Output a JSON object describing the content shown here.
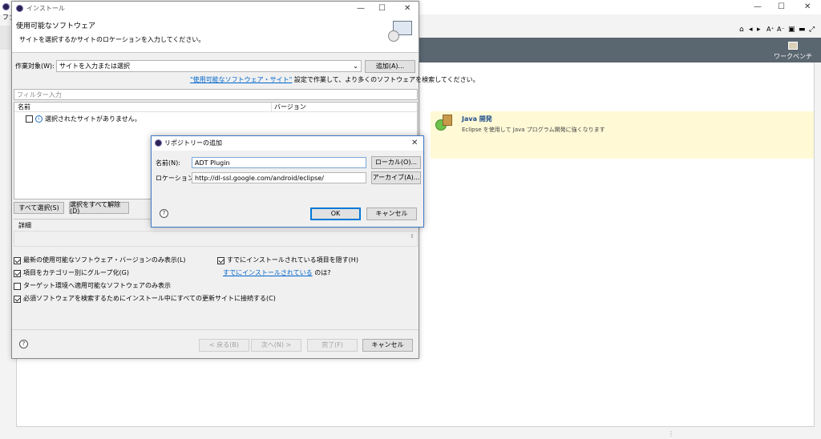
{
  "main_window": {
    "menu_fragment": "ファ",
    "controls": {
      "minimize": "—",
      "maximize": "☐",
      "close": "✕"
    }
  },
  "perspective": {
    "label": "ワークベンチ"
  },
  "welcome": {
    "java_title": "Java 開発",
    "java_desc": "Eclipse を使用して Java プログラム開発に強くなります"
  },
  "install_dialog": {
    "title": "インストール",
    "header_title": "使用可能なソフトウェア",
    "header_desc": "サイトを選択するかサイトのロケーションを入力してください。",
    "work_with_label": "作業対象(W):",
    "work_with_value": "サイトを入力または選択",
    "add_button": "追加(A)...",
    "available_sites_link": "\"使用可能なソフトウェア・サイト\"",
    "available_sites_suffix": " 設定で作業して、より多くのソフトウェアを検索してください。",
    "filter_placeholder": "フィルター入力",
    "columns": {
      "name": "名前",
      "version": "バージョン"
    },
    "tree_message": "選択されたサイトがありません。",
    "select_all": "すべて選択(S)",
    "deselect_all": "選択をすべて解除(D)",
    "details_label": "詳細",
    "options": {
      "latest_only": "最新の使用可能なソフトウェア・バージョンのみ表示(L)",
      "group_by_category": "項目をカテゴリー別にグループ化(G)",
      "target_env_only": "ターゲット環境へ適用可能なソフトウェアのみ表示",
      "contact_all_sites": "必須ソフトウェアを検索するためにインストール中にすべての更新サイトに接続する(C)",
      "hide_installed": "すでにインストールされている項目を隠す(H)",
      "already_installed_link": "すでにインストールされている",
      "already_installed_suffix": " のは?"
    },
    "buttons": {
      "back": "< 戻る(B)",
      "next": "次へ(N) >",
      "finish": "完了(F)",
      "cancel": "キャンセル"
    }
  },
  "repo_dialog": {
    "title": "リポジトリーの追加",
    "name_label": "名前(N):",
    "name_value": "ADT Plugin",
    "local_button": "ローカル(O)...",
    "location_label": "ロケーション(L):",
    "location_value": "http://dl-ssl.google.com/android/eclipse/",
    "archive_button": "アーカイブ(A)...",
    "ok_button": "OK",
    "cancel_button": "キャンセル"
  },
  "colors": {
    "dark_bar": "#5a6670",
    "accent": "#0078d7",
    "welcome_highlight": "#fff9d6",
    "link": "#0066cc"
  }
}
